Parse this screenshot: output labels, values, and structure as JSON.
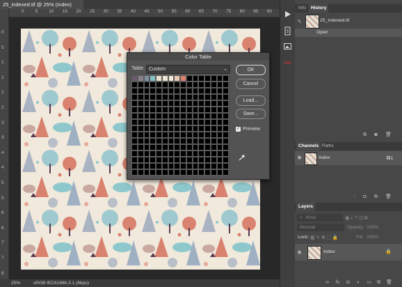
{
  "document": {
    "tab_title": "25_indexed.tif @ 25% (Index)",
    "zoom": "25%",
    "profile": "sRGB IEC61966-2.1 (8bpc)"
  },
  "rulers": {
    "top": [
      "0",
      "5",
      "10",
      "15",
      "20",
      "25",
      "30",
      "35",
      "40",
      "45",
      "50",
      "55",
      "60",
      "65",
      "70",
      "75",
      "80",
      "85",
      "90"
    ],
    "left": [
      "0",
      "5",
      "1",
      "1",
      "2",
      "2",
      "3",
      "3",
      "4",
      "4",
      "5",
      "5",
      "6",
      "6",
      "7",
      "7",
      "8"
    ]
  },
  "history_panel": {
    "tabs": [
      "Info",
      "History"
    ],
    "active_tab": "History",
    "snapshot": "25_indexed.tif",
    "items": [
      "Open"
    ]
  },
  "channels_panel": {
    "tabs": [
      "Channels",
      "Paths"
    ],
    "active_tab": "Channels",
    "channel_name": "Index",
    "shortcut": "⌘1"
  },
  "layers_panel": {
    "tab": "Layers",
    "filter_kind": "Kind",
    "blend_mode": "Normal",
    "opacity_label": "Opacity:",
    "opacity_value": "100%",
    "lock_label": "Lock:",
    "fill_label": "Fill:",
    "fill_value": "100%",
    "layer_name": "Index"
  },
  "color_table_dialog": {
    "title": "Color Table",
    "table_label": "Table:",
    "table_value": "Custom",
    "buttons": {
      "ok": "OK",
      "cancel": "Cancel",
      "load": "Load...",
      "save": "Save..."
    },
    "preview_label": "Preview",
    "preview_checked": true,
    "swatches": [
      "#6a5a6b",
      "#8a7f8c",
      "#7d8f9e",
      "#84c0c6",
      "#e8dfd0",
      "#efe5d3",
      "#f2ead8",
      "#e9c7b5",
      "#d97f6c"
    ]
  }
}
